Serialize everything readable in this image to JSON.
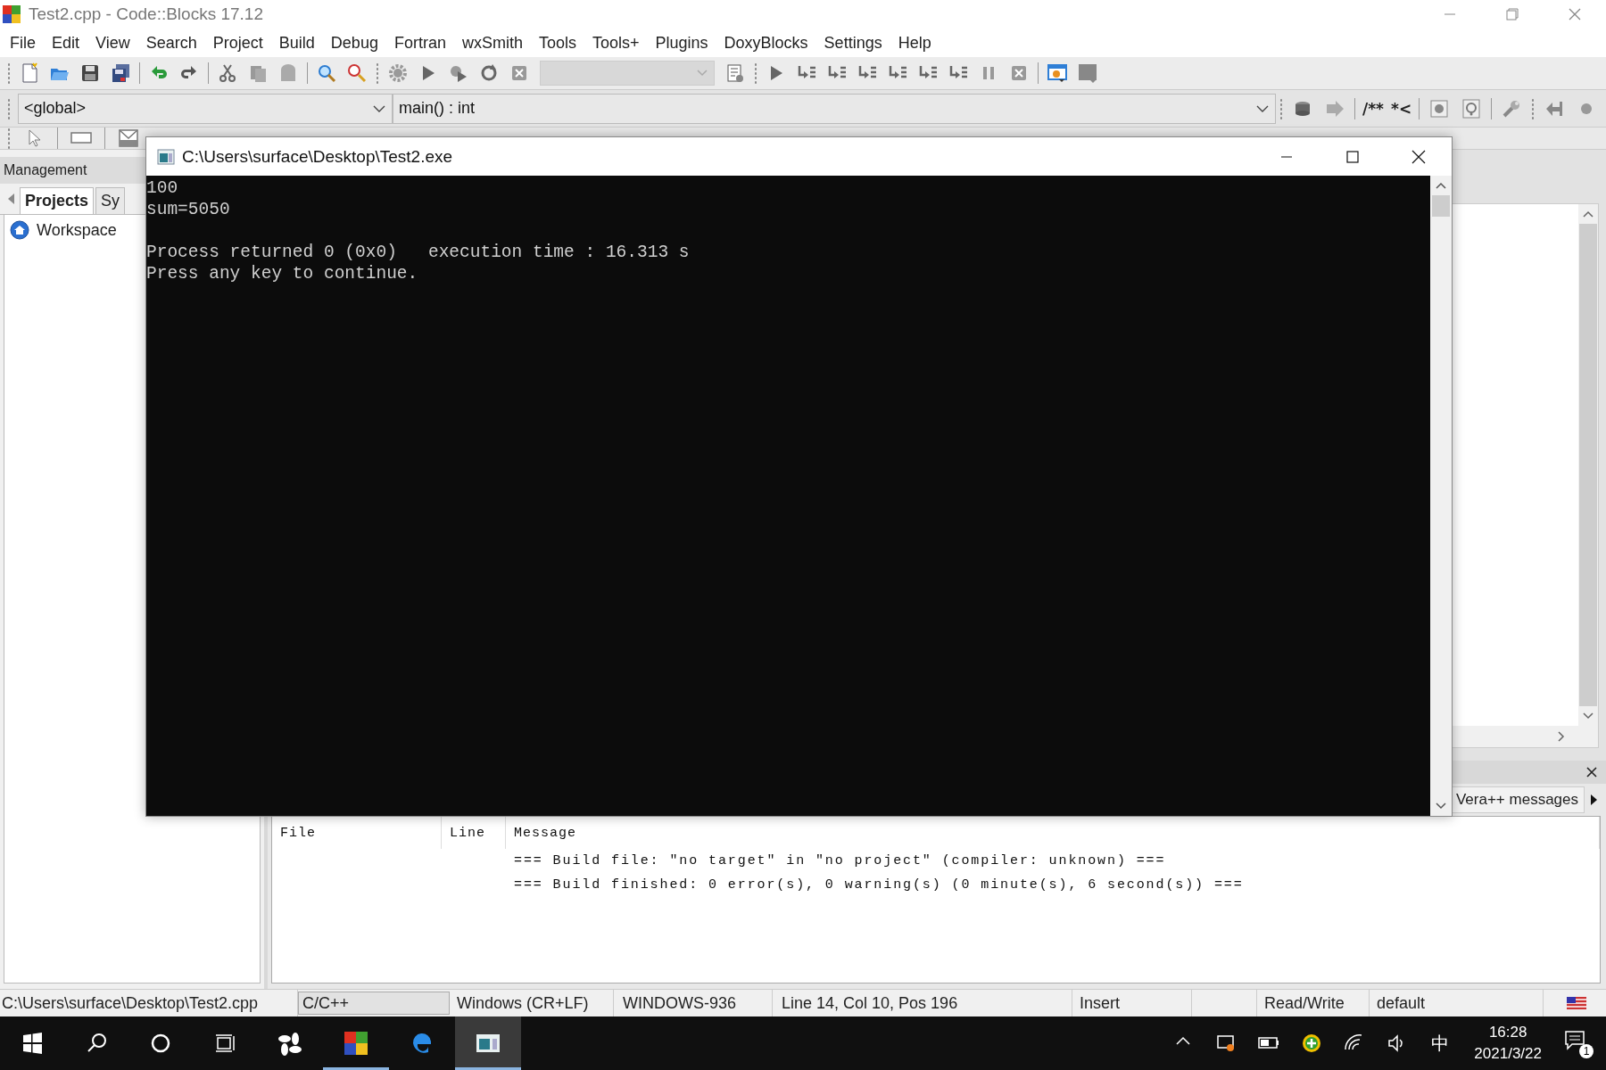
{
  "window": {
    "title": "Test2.cpp - Code::Blocks 17.12"
  },
  "menu": [
    "File",
    "Edit",
    "View",
    "Search",
    "Project",
    "Build",
    "Debug",
    "Fortran",
    "wxSmith",
    "Tools",
    "Tools+",
    "Plugins",
    "DoxyBlocks",
    "Settings",
    "Help"
  ],
  "code_completion": {
    "scope": "<global>",
    "function": "main() : int"
  },
  "doxyblocks_buttons": [
    "/**",
    "*<"
  ],
  "management": {
    "title": "Management",
    "tabs": [
      {
        "label": "Projects",
        "selected": true
      },
      {
        "label": "Sy",
        "selected": false
      }
    ],
    "tree": [
      {
        "label": "Workspace"
      }
    ]
  },
  "logs": {
    "tabs": [
      {
        "label": "Vera++ messages",
        "selected": false
      }
    ],
    "columns": [
      "File",
      "Line",
      "Message"
    ],
    "rows": [
      {
        "message": "=== Build file: \"no target\" in \"no project\" (compiler: unknown) ==="
      },
      {
        "message": "=== Build finished: 0 error(s), 0 warning(s) (0 minute(s), 6 second(s)) ==="
      }
    ]
  },
  "console": {
    "title": "C:\\Users\\surface\\Desktop\\Test2.exe",
    "paragraphs": [
      [
        "100",
        "sum=5050"
      ],
      [
        "Process returned 0 (0x0)   execution time : 16.313 s",
        "Press any key to continue."
      ]
    ]
  },
  "status_bar": [
    "C:\\Users\\surface\\Desktop\\Test2.cpp",
    "C/C++",
    "Windows (CR+LF)",
    "WINDOWS-936",
    "Line 14, Col 10, Pos 196",
    "Insert",
    "Read/Write",
    "default"
  ],
  "taskbar": {
    "apps": [
      {
        "kind": "fan",
        "selected": false,
        "running": false
      },
      {
        "kind": "codeblocks",
        "selected": false,
        "running": true
      },
      {
        "kind": "edge",
        "selected": false,
        "running": false
      },
      {
        "kind": "console",
        "selected": true,
        "running": true
      }
    ],
    "ime": "中",
    "time": "16:28",
    "date": "2021/3/22",
    "notifications": "1"
  }
}
